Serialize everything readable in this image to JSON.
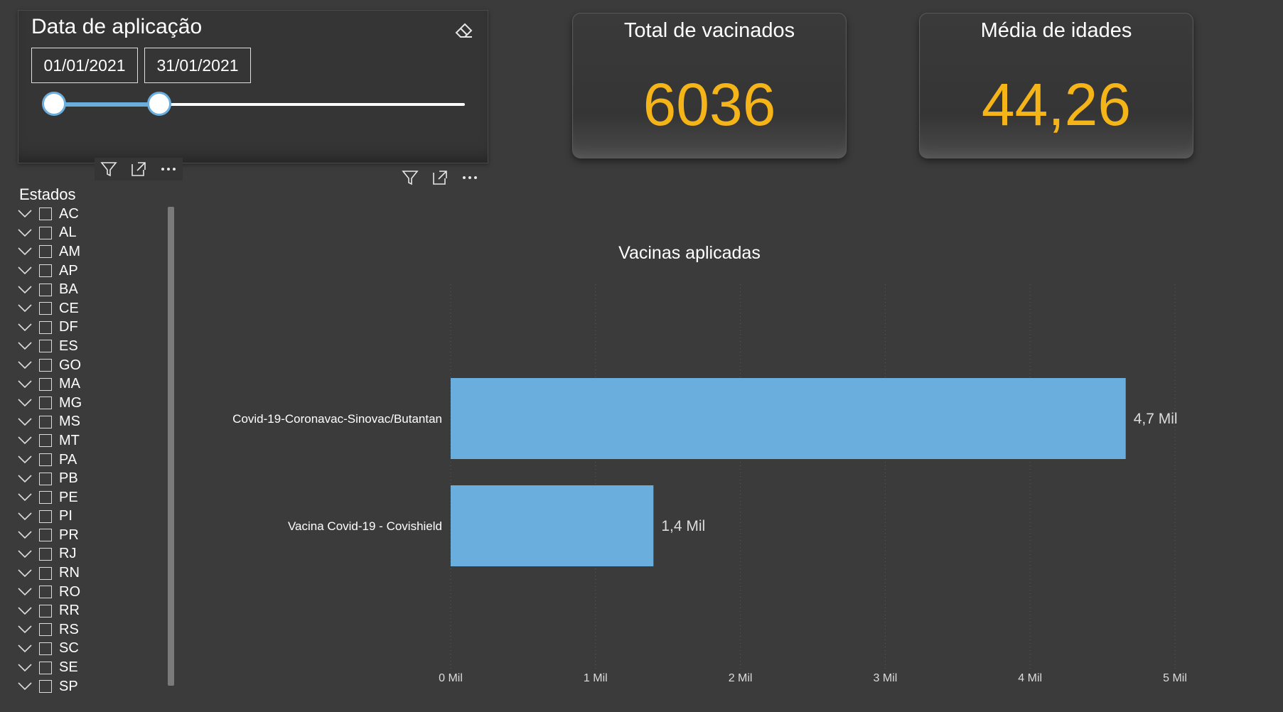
{
  "slicer": {
    "title": "Data de aplicação",
    "start_date": "01/01/2021",
    "end_date": "31/01/2021",
    "range_fraction": [
      0.0,
      0.267
    ]
  },
  "kpis": {
    "total_vacinados": {
      "title": "Total de vacinados",
      "value": "6036"
    },
    "media_idades": {
      "title": "Média de idades",
      "value": "44,26"
    }
  },
  "estados": {
    "title": "Estados",
    "items": [
      "AC",
      "AL",
      "AM",
      "AP",
      "BA",
      "CE",
      "DF",
      "ES",
      "GO",
      "MA",
      "MG",
      "MS",
      "MT",
      "PA",
      "PB",
      "PE",
      "PI",
      "PR",
      "RJ",
      "RN",
      "RO",
      "RR",
      "RS",
      "SC",
      "SE",
      "SP"
    ]
  },
  "colors": {
    "background": "#3b3b3b",
    "accent_kpi": "#f5b417",
    "bar": "#6aaede"
  },
  "icons": [
    "eraser-icon",
    "filter-icon",
    "focus-mode-icon",
    "more-options-icon",
    "chevron-down-icon"
  ],
  "chart_data": {
    "type": "bar",
    "orientation": "horizontal",
    "title": "Vacinas aplicadas",
    "categories": [
      "Covid-19-Coronavac-Sinovac/Butantan",
      "Vacina Covid-19 - Covishield"
    ],
    "values": [
      4660,
      1400
    ],
    "data_labels": [
      "4,7 Mil",
      "1,4 Mil"
    ],
    "xlim": [
      0,
      5000
    ],
    "x_ticks": [
      0,
      1000,
      2000,
      3000,
      4000,
      5000
    ],
    "x_tick_labels": [
      "0 Mil",
      "1 Mil",
      "2 Mil",
      "3 Mil",
      "4 Mil",
      "5 Mil"
    ],
    "grid": true
  }
}
